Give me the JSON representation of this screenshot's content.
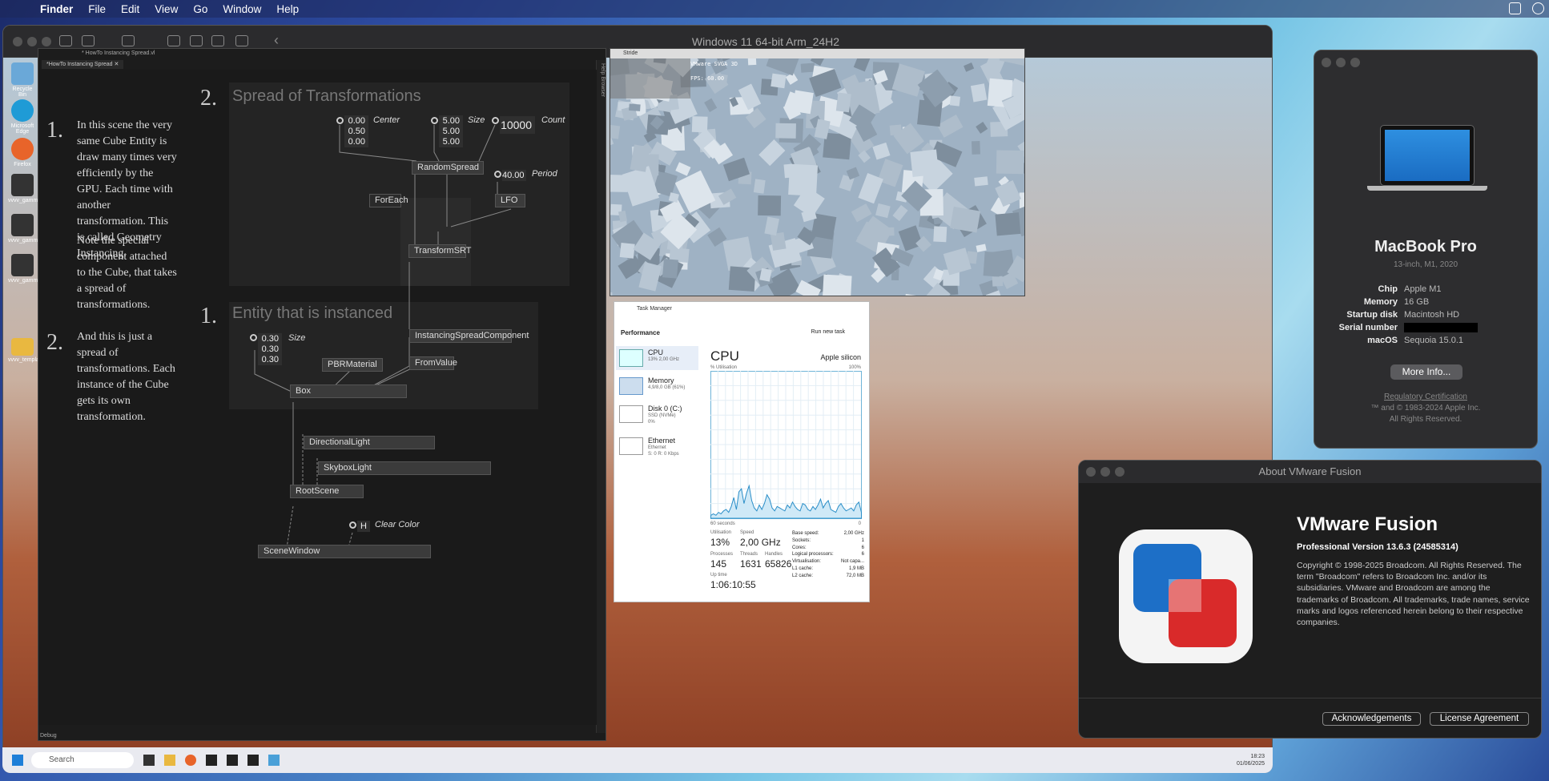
{
  "menubar": {
    "items": [
      "Finder",
      "File",
      "Edit",
      "View",
      "Go",
      "Window",
      "Help"
    ]
  },
  "vm": {
    "title": "Windows 11 64-bit Arm_24H2"
  },
  "desktop_icons": [
    "Recycle Bin",
    "Microsoft Edge",
    "Firefox",
    "vvvv_gamma",
    "vvvv_gamma",
    "vvvv_gamma",
    "vvvv_templates"
  ],
  "vvvv": {
    "title": "* HowTo Instancing Spread.vl",
    "tab": "*HowTo Instancing Spread",
    "help_browser": "Help Browser",
    "debug": "Debug",
    "s1_num": "1.",
    "s1_text": "In this scene the very same Cube Entity is draw many times very efficiently by the GPU. Each time with another transformation. This is called Geometry Instancing.",
    "s1_note": "Note the special component attached to the Cube, that takes a spread of transformations.",
    "s2_num": "2.",
    "s2_text": "And this is just a spread of transformations. Each instance of the Cube gets its own transformation.",
    "r2_num": "2.",
    "r2_title": "Spread of Transformations",
    "r1_num": "1.",
    "r1_title": "Entity that is instanced",
    "center_vals": [
      "0.00",
      "0.50",
      "0.00"
    ],
    "center_lbl": "Center",
    "size_vals": [
      "5.00",
      "5.00",
      "5.00"
    ],
    "size_lbl": "Size",
    "count_val": "10000",
    "count_lbl": "Count",
    "period_val": "40.00",
    "period_lbl": "Period",
    "box_vals": [
      "0.30",
      "0.30",
      "0.30"
    ],
    "box_lbl": "Size",
    "clear_val": "H",
    "clear_lbl": "Clear Color",
    "nodes": {
      "randomspread": "RandomSpread",
      "foreach": "ForEach",
      "lfo": "LFO",
      "transformsrt": "TransformSRT",
      "instcomp": "InstancingSpreadComponent",
      "pbr": "PBRMaterial",
      "fromvalue": "FromValue",
      "box": "Box",
      "dirlight": "DirectionalLight",
      "skybox": "SkyboxLight",
      "rootscene": "RootScene",
      "scenewindow": "SceneWindow"
    }
  },
  "stride": {
    "title": "Stride",
    "overlay1": "VMware SVGA 3D",
    "overlay2": "FPS: 60.00"
  },
  "taskmgr": {
    "title": "Task Manager",
    "section": "Performance",
    "run": "Run new task",
    "items": [
      {
        "name": "CPU",
        "sub": "13% 2,00 GHz"
      },
      {
        "name": "Memory",
        "sub": "4,9/8,0 GB (61%)"
      },
      {
        "name": "Disk 0 (C:)",
        "sub": "SSD (NVMe)",
        "sub2": "0%"
      },
      {
        "name": "Ethernet",
        "sub": "Ethernet",
        "sub2": "S: 0 R: 0 Kbps"
      }
    ],
    "cpu_title": "CPU",
    "cpu_model": "Apple silicon",
    "util_lbl": "% Utilisation",
    "util_max": "100%",
    "time_lbl": "60 seconds",
    "time_min": "0",
    "stats": {
      "utilisation_lbl": "Utilisation",
      "utilisation": "13%",
      "speed_lbl": "Speed",
      "speed": "2,00 GHz",
      "processes_lbl": "Processes",
      "processes": "145",
      "threads_lbl": "Threads",
      "threads": "1631",
      "handles_lbl": "Handles",
      "handles": "65826",
      "uptime_lbl": "Up time",
      "uptime": "1:06:10:55"
    },
    "specs": [
      [
        "Base speed:",
        "2,00 GHz"
      ],
      [
        "Sockets:",
        "1"
      ],
      [
        "Cores:",
        "6"
      ],
      [
        "Logical processors:",
        "6"
      ],
      [
        "Virtualisation:",
        "Not capa..."
      ],
      [
        "L1 cache:",
        "1,9 MB"
      ],
      [
        "L2 cache:",
        "72,0 MB"
      ]
    ],
    "cpu_history": [
      2,
      3,
      2,
      4,
      3,
      5,
      6,
      4,
      8,
      14,
      6,
      18,
      20,
      10,
      17,
      22,
      12,
      7,
      5,
      9,
      6,
      10,
      16,
      13,
      7,
      5,
      8,
      7,
      6,
      5,
      9,
      7,
      11,
      8,
      6,
      5,
      10,
      9,
      6,
      5,
      8,
      6,
      9,
      13,
      7,
      10,
      12,
      6,
      5,
      4,
      8,
      10,
      7,
      5,
      6,
      7,
      5,
      9,
      11,
      4
    ]
  },
  "taskbar": {
    "search": "Search",
    "time": "18:23",
    "date": "01/06/2025"
  },
  "mac": {
    "name": "MacBook Pro",
    "model": "13-inch, M1, 2020",
    "specs": [
      [
        "Chip",
        "Apple M1"
      ],
      [
        "Memory",
        "16 GB"
      ],
      [
        "Startup disk",
        "Macintosh HD"
      ],
      [
        "Serial number",
        ""
      ],
      [
        "macOS",
        "Sequoia 15.0.1"
      ]
    ],
    "more_info": "More Info...",
    "reg": "Regulatory Certification",
    "copy1": "™ and © 1983-2024 Apple Inc.",
    "copy2": "All Rights Reserved."
  },
  "about": {
    "title": "About VMware Fusion",
    "product": "VMware Fusion",
    "version": "Professional Version 13.6.3 (24585314)",
    "copyright": "Copyright © 1998-2025 Broadcom. All Rights Reserved. The term \"Broadcom\" refers to Broadcom Inc. and/or its subsidiaries. VMware and Broadcom are among the trademarks of Broadcom. All trademarks, trade names, service marks and logos referenced herein belong to their respective companies.",
    "ack": "Acknowledgements",
    "license": "License Agreement"
  }
}
